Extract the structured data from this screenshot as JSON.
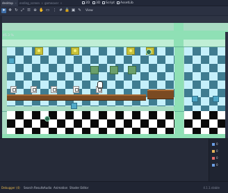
{
  "tabs": [
    {
      "label": "desktop",
      "active": true
    },
    {
      "label": "ending_screen",
      "active": false
    },
    {
      "label": "gameover",
      "active": false
    }
  ],
  "workspaces": {
    "w2d": "2D",
    "w3d": "3D",
    "script": "Script",
    "assetlib": "AssetLib"
  },
  "toolbar": {
    "view_label": "View"
  },
  "viewport": {
    "zoom": "45.3 %"
  },
  "sidebar": {
    "items": [
      {
        "label": "0",
        "icon": "node-icon"
      },
      {
        "label": "0",
        "icon": "warning-icon"
      },
      {
        "label": "0",
        "icon": "error-icon"
      },
      {
        "label": "0",
        "icon": "info-icon"
      }
    ]
  },
  "statusbar": {
    "debugger": "Debugger (4)",
    "search_results": "Search Results",
    "audio": "Audio",
    "animation": "Animation",
    "shader_editor": "Shader Editor",
    "version": "4.1.1.stable"
  },
  "colors": {
    "accent": "#3f6ea8",
    "canvas_band": "#8fe0b5",
    "check_dark": "#3f7c90",
    "check_light": "#c5f0fb"
  }
}
